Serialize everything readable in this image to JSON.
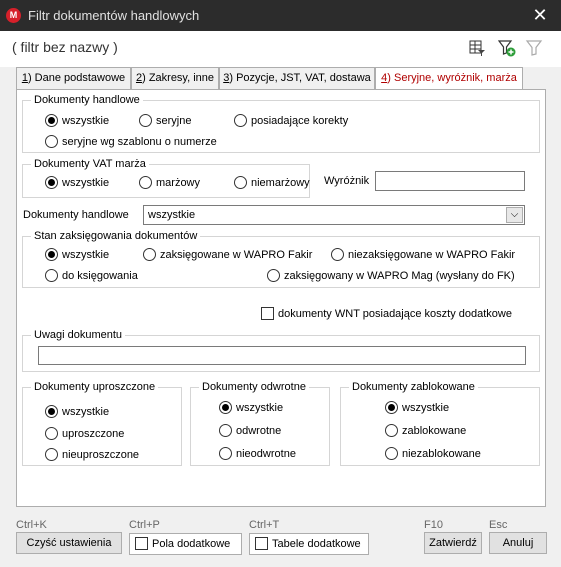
{
  "window": {
    "title": "Filtr dokumentów handlowych",
    "app_icon_letter": "M",
    "close": "✕"
  },
  "header": {
    "filter_name": "( filtr bez nazwy )"
  },
  "tabs": [
    {
      "num": "1",
      "label": ") Dane podstawowe"
    },
    {
      "num": "2",
      "label": ") Zakresy, inne"
    },
    {
      "num": "3",
      "label": ") Pozycje, JST, VAT, dostawa"
    },
    {
      "num": "4",
      "label": ") Seryjne, wyróżnik, marża"
    }
  ],
  "dok_handlowe_group": {
    "title": "Dokumenty handlowe",
    "options": [
      "wszystkie",
      "seryjne",
      "posiadające korekty",
      "seryjne wg szablonu o numerze"
    ],
    "selected": "wszystkie"
  },
  "vat_marza_group": {
    "title": "Dokumenty VAT marża",
    "options": [
      "wszystkie",
      "marżowy",
      "niemarżowy"
    ],
    "selected": "wszystkie"
  },
  "wyroznik": {
    "label": "Wyróżnik",
    "value": ""
  },
  "dok_handlowe_select": {
    "label": "Dokumenty handlowe",
    "value": "wszystkie",
    "arrow": "⌵"
  },
  "stan_group": {
    "title": "Stan zaksięgowania dokumentów",
    "options": [
      "wszystkie",
      "zaksięgowane w WAPRO Fakir",
      "niezaksięgowane w WAPRO Fakir",
      "do księgowania",
      "zaksięgowany w WAPRO Mag (wysłany do FK)"
    ],
    "selected": "wszystkie"
  },
  "wnt_check": {
    "label": "dokumenty WNT posiadające koszty dodatkowe",
    "checked": false
  },
  "uwagi": {
    "title": "Uwagi dokumentu",
    "value": ""
  },
  "uproszczone_group": {
    "title": "Dokumenty uproszczone",
    "options": [
      "wszystkie",
      "uproszczone",
      "nieuproszczone"
    ],
    "selected": "wszystkie"
  },
  "odwrotne_group": {
    "title": "Dokumenty odwrotne",
    "options": [
      "wszystkie",
      "odwrotne",
      "nieodwrotne"
    ],
    "selected": "wszystkie"
  },
  "zablokowane_group": {
    "title": "Dokumenty zablokowane",
    "options": [
      "wszystkie",
      "zablokowane",
      "niezablokowane"
    ],
    "selected": "wszystkie"
  },
  "footer": {
    "clear": {
      "shortcut": "Ctrl+K",
      "label": "Czyść ustawienia"
    },
    "extra_fields": {
      "shortcut": "Ctrl+P",
      "label": "Pola dodatkowe"
    },
    "extra_tables": {
      "shortcut": "Ctrl+T",
      "label": "Tabele dodatkowe"
    },
    "confirm": {
      "shortcut": "F10",
      "label": "Zatwierdź"
    },
    "cancel": {
      "shortcut": "Esc",
      "label": "Anuluj"
    }
  },
  "colors": {
    "titlebar": "#2c2c2c",
    "active_tab_text": "#b00000",
    "app_icon": "#d6202a"
  }
}
